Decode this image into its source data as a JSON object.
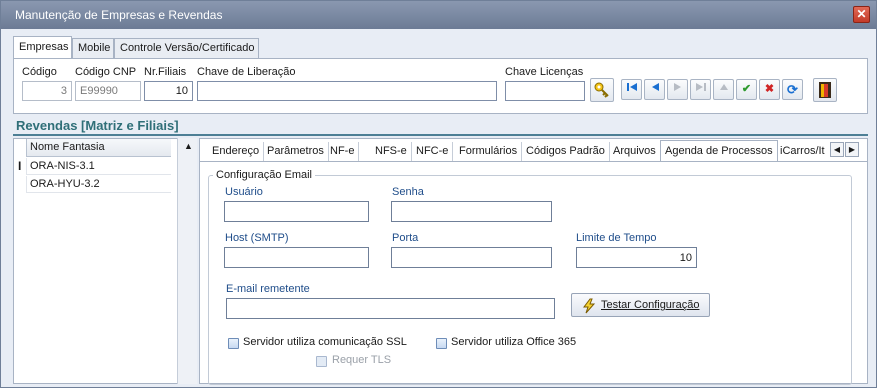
{
  "window": {
    "title": "Manutenção de Empresas e Revendas"
  },
  "top_tabs": [
    "Empresas",
    "Mobile",
    "Controle Versão/Certificado"
  ],
  "empresa": {
    "codigo_label": "Código",
    "codigo_value": "3",
    "codigo_cnp_label": "Código CNP",
    "codigo_cnp_value": "E99990",
    "nr_filiais_label": "Nr.Filiais",
    "nr_filiais_value": "10",
    "chave_liberacao_label": "Chave de Liberação",
    "chave_liberacao_value": "",
    "chave_licencas_label": "Chave Licenças",
    "chave_licencas_value": ""
  },
  "toolbar": [
    "key-icon",
    "first-record-icon",
    "prev-record-icon",
    "next-record-icon",
    "last-record-icon",
    "up-icon",
    "confirm-check-icon",
    "cancel-x-icon",
    "refresh-icon",
    "exit-door-icon"
  ],
  "revendas": {
    "header": "Revendas [Matriz e Filiais]",
    "column": "Nome Fantasia",
    "rows": [
      "ORA-NIS-3.1",
      "ORA-HYU-3.2"
    ]
  },
  "detail_tabs": [
    "Endereço",
    "Parâmetros",
    "NF-e",
    "NFS-e",
    "NFC-e",
    "Formulários",
    "Códigos Padrão",
    "Arquivos",
    "Agenda de Processos",
    "iCarros/It"
  ],
  "config_email": {
    "group_title": "Configuração Email",
    "usuario_label": "Usuário",
    "usuario_value": "",
    "senha_label": "Senha",
    "senha_value": "",
    "host_label": "Host (SMTP)",
    "host_value": "",
    "porta_label": "Porta",
    "porta_value": "",
    "limite_label": "Limite de Tempo",
    "limite_value": "10",
    "remetente_label": "E-mail remetente",
    "remetente_value": "",
    "testar_label": "Testar Configuração",
    "ssl_label": "Servidor utiliza comunicação SSL",
    "office365_label": "Servidor utiliza Office 365",
    "tls_label": "Requer TLS"
  },
  "colors": {
    "title_bar": "#7a889f",
    "section_header": "#2f6f78",
    "field_label": "#1f4d8a",
    "close_button": "#c9402e"
  }
}
